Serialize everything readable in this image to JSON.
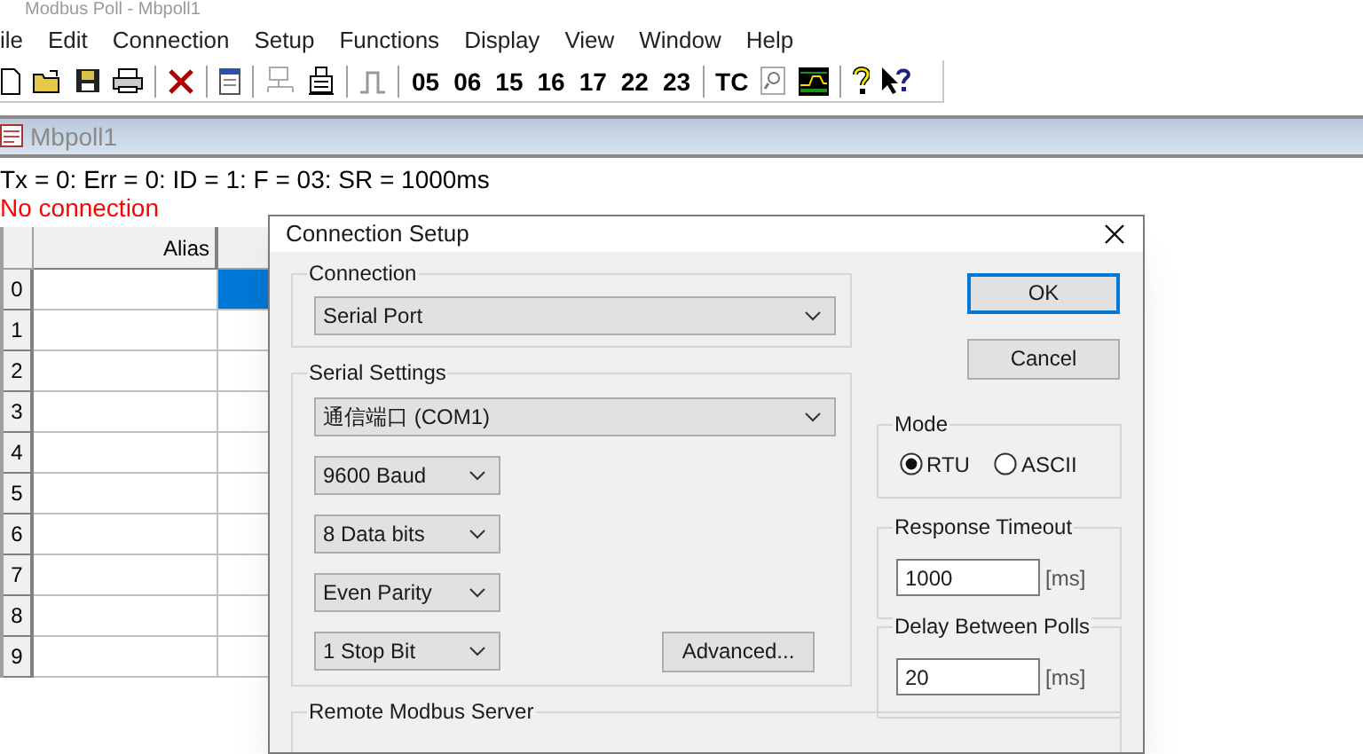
{
  "app_title": "Modbus Poll - Mbpoll1",
  "menu": [
    "ile",
    "Edit",
    "Connection",
    "Setup",
    "Functions",
    "Display",
    "View",
    "Window",
    "Help"
  ],
  "toolbar": {
    "function_codes": [
      "05",
      "06",
      "15",
      "16",
      "17",
      "22",
      "23"
    ],
    "tc": "TC"
  },
  "document": {
    "title": "Mbpoll1",
    "status": "Tx = 0: Err = 0: ID = 1: F = 03: SR = 1000ms",
    "connection_status": "No connection",
    "table": {
      "columns": [
        "Alias"
      ],
      "rows": [
        {
          "index": "0",
          "selected": true
        },
        {
          "index": "1",
          "selected": false
        },
        {
          "index": "2",
          "selected": false
        },
        {
          "index": "3",
          "selected": false
        },
        {
          "index": "4",
          "selected": false
        },
        {
          "index": "5",
          "selected": false
        },
        {
          "index": "6",
          "selected": false
        },
        {
          "index": "7",
          "selected": false
        },
        {
          "index": "8",
          "selected": false
        },
        {
          "index": "9",
          "selected": false
        }
      ]
    }
  },
  "dialog": {
    "title": "Connection Setup",
    "connection": {
      "label": "Connection",
      "value": "Serial Port"
    },
    "serial_settings": {
      "label": "Serial Settings",
      "port": "通信端口 (COM1)",
      "baud": "9600 Baud",
      "data_bits": "8 Data bits",
      "parity": "Even Parity",
      "stop_bits": "1 Stop Bit",
      "advanced_button": "Advanced..."
    },
    "buttons": [
      {
        "label": "OK",
        "default": true
      },
      {
        "label": "Cancel",
        "default": false
      }
    ],
    "mode": {
      "label": "Mode",
      "options": [
        {
          "label": "RTU",
          "selected": true
        },
        {
          "label": "ASCII",
          "selected": false
        }
      ]
    },
    "response_timeout": {
      "label": "Response Timeout",
      "value": "1000",
      "unit": "[ms]"
    },
    "delay_between_polls": {
      "label": "Delay Between Polls",
      "value": "20",
      "unit": "[ms]"
    },
    "remote_server": {
      "label": "Remote Modbus Server"
    }
  }
}
